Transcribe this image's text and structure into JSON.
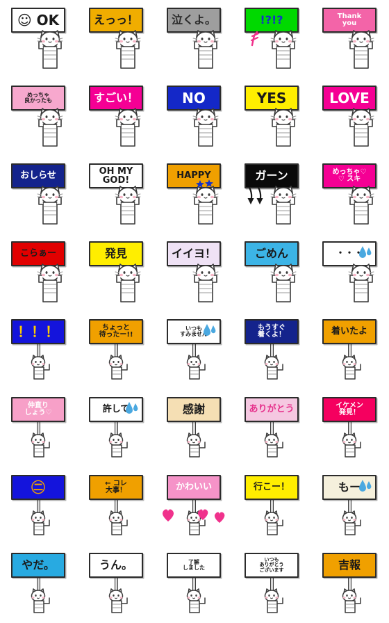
{
  "grid": {
    "columns": 5,
    "rows": 8,
    "background": "#ffffff"
  },
  "stickers": [
    {
      "id": "ok",
      "text": "☺ OK",
      "sign_bg": "#ffffff",
      "text_color": "#1a1a1a",
      "size": "xl",
      "pose": "up",
      "deco": "none"
    },
    {
      "id": "ettsu",
      "text": "えっっ！",
      "sign_bg": "#f0ad00",
      "text_color": "#1a1a1a",
      "size": "lg",
      "pose": "up",
      "deco": "none"
    },
    {
      "id": "nakuyo",
      "text": "泣くよ。",
      "sign_bg": "#9e9e9e",
      "text_color": "#2b2b2b",
      "size": "lg",
      "pose": "up",
      "deco": "none"
    },
    {
      "id": "interrobang",
      "text": "!?!?",
      "sign_bg": "#00d900",
      "text_color": "#1432c8",
      "size": "lg",
      "pose": "up",
      "deco": "note"
    },
    {
      "id": "thankyou",
      "text": "Thank\nyou",
      "sign_bg": "#f364a8",
      "text_color": "#ffffff",
      "size": "sm",
      "pose": "up",
      "deco": "none"
    },
    {
      "id": "meccha-yokatta",
      "text": "めっちゃ\n良かったも",
      "sign_bg": "#f7a8ce",
      "text_color": "#1a1a1a",
      "size": "xs",
      "pose": "up",
      "deco": "none"
    },
    {
      "id": "sugoi",
      "text": "すごい！",
      "sign_bg": "#f50094",
      "text_color": "#ffffff",
      "size": "lg",
      "pose": "up",
      "deco": "none"
    },
    {
      "id": "no",
      "text": "NO",
      "sign_bg": "#1428c8",
      "text_color": "#ffffff",
      "size": "xl",
      "pose": "up",
      "deco": "none"
    },
    {
      "id": "yes",
      "text": "YES",
      "sign_bg": "#ffee00",
      "text_color": "#1a1a1a",
      "size": "xl",
      "pose": "up",
      "deco": "none"
    },
    {
      "id": "love",
      "text": "LOVE",
      "sign_bg": "#f50094",
      "text_color": "#ffffff",
      "size": "xl",
      "pose": "up",
      "deco": "none"
    },
    {
      "id": "oshirase",
      "text": "おしらせ",
      "sign_bg": "#14238c",
      "text_color": "#ffffff",
      "size": "md",
      "pose": "up",
      "deco": "none"
    },
    {
      "id": "ohmygod",
      "text": "OH MY\nGOD!",
      "sign_bg": "#ffffff",
      "text_color": "#1a1a1a",
      "size": "md",
      "pose": "up",
      "deco": "none"
    },
    {
      "id": "happy",
      "text": "HAPPY",
      "sign_bg": "#f0a000",
      "text_color": "#1a1a1a",
      "size": "md",
      "pose": "up",
      "deco": "stars"
    },
    {
      "id": "gaan",
      "text": "ガーン",
      "sign_bg": "#0a0a0a",
      "text_color": "#ffffff",
      "size": "lg",
      "pose": "up",
      "deco": "arrows"
    },
    {
      "id": "meccha-suki",
      "text": "めっちゃ♡\n♡ スキ",
      "sign_bg": "#f50094",
      "text_color": "#ffffff",
      "size": "sm",
      "pose": "up",
      "deco": "none"
    },
    {
      "id": "koraa",
      "text": "こらぁー",
      "sign_bg": "#e10000",
      "text_color": "#1a1a1a",
      "size": "md",
      "pose": "up",
      "deco": "none"
    },
    {
      "id": "hakken",
      "text": "発見",
      "sign_bg": "#ffee00",
      "text_color": "#1a1a1a",
      "size": "lg",
      "pose": "up",
      "deco": "none"
    },
    {
      "id": "iiyo",
      "text": "イイヨ！",
      "sign_bg": "#efe2f5",
      "text_color": "#1a1a1a",
      "size": "lg",
      "pose": "up",
      "deco": "none"
    },
    {
      "id": "gomen",
      "text": "ごめん",
      "sign_bg": "#3cb4e6",
      "text_color": "#1a1a1a",
      "size": "lg",
      "pose": "up",
      "deco": "none"
    },
    {
      "id": "dots-sweat",
      "text": "・・・",
      "sign_bg": "#ffffff",
      "text_color": "#1a1a1a",
      "size": "md",
      "pose": "up",
      "deco": "sweat-sign"
    },
    {
      "id": "exclaim3",
      "text": "！！！",
      "sign_bg": "#1414dc",
      "text_color": "#ffcc00",
      "size": "xl",
      "pose": "pole",
      "deco": "none"
    },
    {
      "id": "chotto-matta",
      "text": "ちょっと\n待ったー!!",
      "sign_bg": "#f0a000",
      "text_color": "#1a1a1a",
      "size": "sm",
      "pose": "pole",
      "deco": "none"
    },
    {
      "id": "itsumo-sumimasen",
      "text": "いつも\nすみません",
      "sign_bg": "#ffffff",
      "text_color": "#1a1a1a",
      "size": "xs",
      "pose": "pole",
      "deco": "sweat-sign"
    },
    {
      "id": "mousugu-tsuku",
      "text": "もうすぐ\n着くよ！",
      "sign_bg": "#14238c",
      "text_color": "#ffffff",
      "size": "sm",
      "pose": "pole",
      "deco": "none"
    },
    {
      "id": "tsuitayo",
      "text": "着いたよ",
      "sign_bg": "#f0a000",
      "text_color": "#1a1a1a",
      "size": "md",
      "pose": "pole",
      "deco": "none"
    },
    {
      "id": "nakanaori",
      "text": "仲直り\nしょう♡",
      "sign_bg": "#f7a0c8",
      "text_color": "#ffffff",
      "size": "sm",
      "pose": "pole",
      "deco": "none"
    },
    {
      "id": "yurushite",
      "text": "許して",
      "sign_bg": "#ffffff",
      "text_color": "#1a1a1a",
      "size": "md",
      "pose": "pole",
      "deco": "sweat-sign"
    },
    {
      "id": "kansha",
      "text": "感謝",
      "sign_bg": "#f5dfb4",
      "text_color": "#1a1a1a",
      "size": "lg",
      "pose": "pole",
      "deco": "none"
    },
    {
      "id": "arigatou",
      "text": "ありがとう",
      "sign_bg": "#f5c8e1",
      "text_color": "#e6328c",
      "size": "md",
      "pose": "pole",
      "deco": "none"
    },
    {
      "id": "ikemen-hakken",
      "text": "イケメン\n発見！",
      "sign_bg": "#f5005f",
      "text_color": "#ffffff",
      "size": "sm",
      "pose": "pole",
      "deco": "none"
    },
    {
      "id": "maruhi",
      "text": "㊁",
      "sign_bg": "#1414dc",
      "text_color": "#f0a000",
      "size": "xl",
      "pose": "pole",
      "deco": "none"
    },
    {
      "id": "kore-daiji",
      "text": "← コレ\n大事！",
      "sign_bg": "#f0a000",
      "text_color": "#1a1a1a",
      "size": "sm",
      "pose": "pole",
      "deco": "none"
    },
    {
      "id": "kawaii",
      "text": "かわいい",
      "sign_bg": "#f593c8",
      "text_color": "#ffffff",
      "size": "md",
      "pose": "pole",
      "deco": "hearts"
    },
    {
      "id": "ikoo",
      "text": "行こー！",
      "sign_bg": "#ffee00",
      "text_color": "#1a1a1a",
      "size": "md",
      "pose": "pole",
      "deco": "none"
    },
    {
      "id": "moo",
      "text": "もー",
      "sign_bg": "#f5f0dc",
      "text_color": "#1a1a1a",
      "size": "lg",
      "pose": "pole",
      "deco": "sweat-sign"
    },
    {
      "id": "yada",
      "text": "やだ。",
      "sign_bg": "#28aae1",
      "text_color": "#1a1a1a",
      "size": "lg",
      "pose": "pole",
      "deco": "none"
    },
    {
      "id": "un",
      "text": "うん。",
      "sign_bg": "#ffffff",
      "text_color": "#1a1a1a",
      "size": "lg",
      "pose": "pole",
      "deco": "none"
    },
    {
      "id": "ryoukai",
      "text": "了解\nしました",
      "sign_bg": "#ffffff",
      "text_color": "#1a1a1a",
      "size": "xs",
      "pose": "pole",
      "deco": "none"
    },
    {
      "id": "itsumo-arigatou",
      "text": "いつも\nありがとう\nございます",
      "sign_bg": "#ffffff",
      "text_color": "#1a1a1a",
      "size": "xxs",
      "pose": "pole",
      "deco": "none"
    },
    {
      "id": "kippou",
      "text": "吉報",
      "sign_bg": "#f0a000",
      "text_color": "#1a1a1a",
      "size": "lg",
      "pose": "pole",
      "deco": "none"
    }
  ],
  "palette": {
    "cat_body": "#ffffff",
    "cat_outline": "#3a3a3a",
    "cat_cheek": "#f7b8c8",
    "sweat_blue": "#4aa8e0",
    "heart_pink": "#f0328c",
    "star_blue": "#1432c8",
    "note_pink": "#f0328c"
  }
}
